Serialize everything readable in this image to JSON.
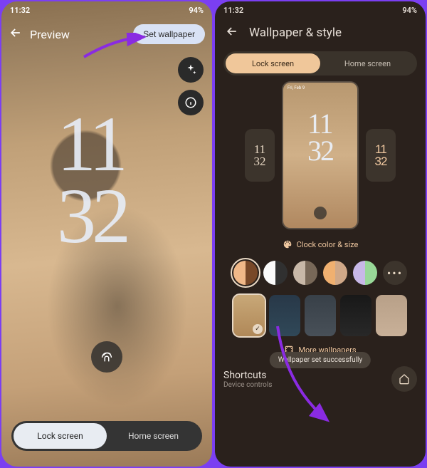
{
  "status": {
    "time": "11:32",
    "battery": "94%"
  },
  "left": {
    "title": "Preview",
    "set_btn": "Set wallpaper",
    "clock_line1": "11",
    "clock_line2": "32",
    "tabs": {
      "lock": "Lock screen",
      "home": "Home screen"
    }
  },
  "right": {
    "title": "Wallpaper & style",
    "tabs": {
      "lock": "Lock screen",
      "home": "Home screen"
    },
    "mini_status": "Fri, Feb 9",
    "mini_clock_line1": "11",
    "mini_clock_line2": "32",
    "clock_color_label": "Clock color & size",
    "swatches": [
      {
        "c1": "#f0b888",
        "c2": "#784828",
        "selected": true
      },
      {
        "c1": "#fafafa",
        "c2": "#303030"
      },
      {
        "c1": "#c8b8a8",
        "c2": "#786858"
      },
      {
        "c1": "#f0b070",
        "c2": "#d0a888"
      },
      {
        "c1": "#c8b8e8",
        "c2": "#98d898"
      }
    ],
    "more_dots": "•••",
    "wallpapers": [
      {
        "bg": "linear-gradient(#c8a878,#b08858)",
        "selected": true
      },
      {
        "bg": "linear-gradient(#283848,#304858)"
      },
      {
        "bg": "linear-gradient(#384048,#485058)"
      },
      {
        "bg": "linear-gradient(#181818,#282828)"
      },
      {
        "bg": "linear-gradient(#b8a088,#c8b098)"
      }
    ],
    "more_wallpapers": "More wallpapers",
    "shortcuts_title": "Shortcuts",
    "shortcuts_sub": "Device controls",
    "toast": "Wallpaper set successfully"
  }
}
